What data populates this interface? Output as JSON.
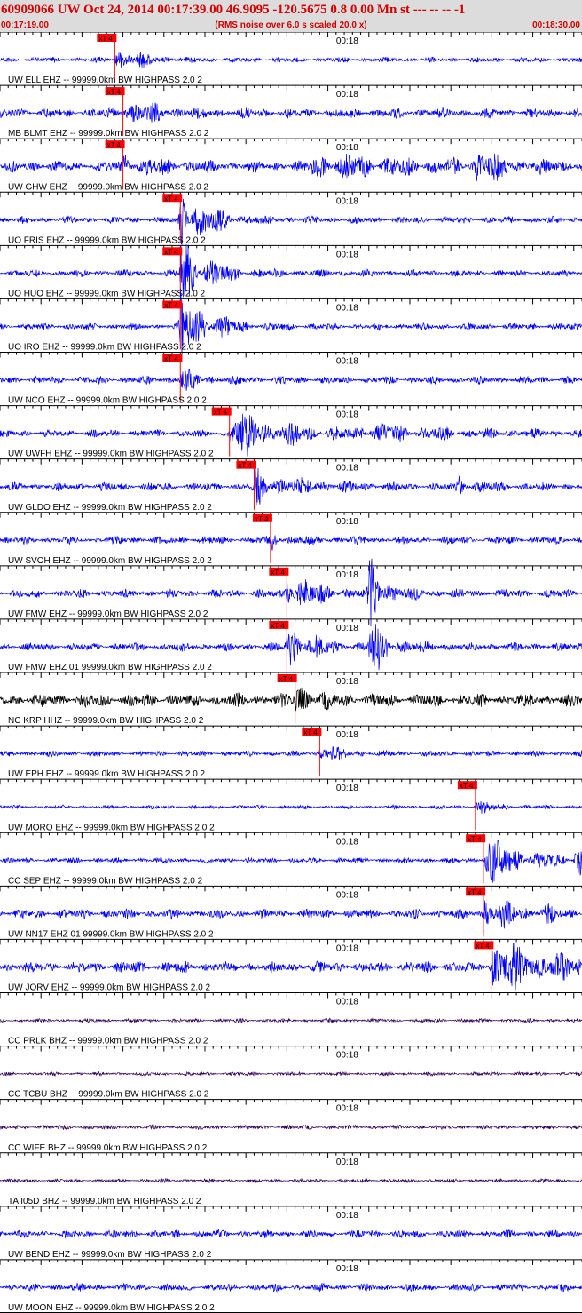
{
  "header": {
    "title": "60909066 UW Oct 24, 2014 00:17:39.00   46.9095 -120.5675  0.8 0.00 Mn st --- -- --   -1",
    "start_time": "00:17:19.00",
    "note": "(RMS noise over 6.0 s scaled 20.0 x)",
    "end_time": "00:18:30.00"
  },
  "chart_data": {
    "type": "seismogram",
    "time_range": [
      "00:17:19.00",
      "00:18:30.00"
    ],
    "time_tick_label": "00:18",
    "pick_label": "xT 4",
    "colors": {
      "blue_trace": "#0000ff",
      "black_trace": "#000000",
      "purple_trace": "#330055",
      "pick": "#ff0000",
      "header_text": "#d40000",
      "header_bg": "#dcdcdc"
    },
    "traces": [
      {
        "label": "UW ELL EHZ -- 99999.0km BW  HIGHPASS  2.0  2",
        "color": "#0000ff",
        "pick": 14,
        "noise": 0.14,
        "events": [
          [
            14,
            3,
            0.7
          ]
        ]
      },
      {
        "label": "MB BLMT EHZ -- 99999.0km BW  HIGHPASS  2.0  2",
        "color": "#0000ff",
        "pick": 15,
        "noise": 0.25,
        "events": [
          [
            15,
            4,
            0.6
          ]
        ]
      },
      {
        "label": "UW GHW EHZ -- 99999.0km BW  HIGHPASS  2.0  2",
        "color": "#0000ff",
        "pick": 15,
        "noise": 0.28,
        "events": [
          [
            15,
            4,
            0.6
          ],
          [
            38,
            14,
            0.55
          ],
          [
            58,
            3,
            0.8
          ]
        ]
      },
      {
        "label": "UO FRIS EHZ -- 99999.0km BW  HIGHPASS  2.0  2",
        "color": "#0000ff",
        "pick": 22,
        "noise": 0.18,
        "events": [
          [
            22,
            3,
            2.2
          ]
        ]
      },
      {
        "label": "UO HUO EHZ -- 99999.0km BW  HIGHPASS  2.0  2",
        "color": "#0000ff",
        "pick": 22,
        "noise": 0.18,
        "events": [
          [
            22,
            3,
            2.2
          ]
        ]
      },
      {
        "label": "UO IRO EHZ -- 99999.0km BW  HIGHPASS  2.0  2",
        "color": "#0000ff",
        "pick": 22,
        "noise": 0.18,
        "events": [
          [
            22,
            3,
            2.2
          ]
        ]
      },
      {
        "label": "UW NCO EHZ -- 99999.0km BW  HIGHPASS  2.0  2",
        "color": "#0000ff",
        "pick": 22,
        "noise": 0.2,
        "events": [
          [
            22,
            2,
            0.6
          ]
        ]
      },
      {
        "label": "UW UWFH EHZ -- 99999.0km BW  HIGHPASS  2.0  2",
        "color": "#0000ff",
        "pick": 28,
        "noise": 0.2,
        "events": [
          [
            28,
            7,
            1.2
          ],
          [
            44,
            8,
            0.4
          ]
        ]
      },
      {
        "label": "UW GLDO EHZ -- 99999.0km BW  HIGHPASS  2.0  2",
        "color": "#0000ff",
        "pick": 31,
        "noise": 0.22,
        "events": [
          [
            31,
            5,
            0.8
          ],
          [
            56,
            2,
            0.5
          ]
        ]
      },
      {
        "label": "UW SVOH EHZ -- 99999.0km BW  HIGHPASS  2.0  2",
        "color": "#0000ff",
        "pick": 33,
        "noise": 0.2,
        "events": [
          [
            33,
            2,
            0.5
          ]
        ]
      },
      {
        "label": "UW FMW EHZ -- 99999.0km BW  HIGHPASS  2.0  2",
        "color": "#0000ff",
        "pick": 35,
        "noise": 0.22,
        "events": [
          [
            35,
            2.5,
            1.8
          ],
          [
            45,
            2,
            1.8
          ],
          [
            75,
            1.5,
            1.6
          ]
        ]
      },
      {
        "label": "UW FMW EHZ 01 99999.0km BW  HIGHPASS  2.0  2",
        "color": "#0000ff",
        "pick": 35,
        "noise": 0.22,
        "events": [
          [
            35,
            2.5,
            1.8
          ],
          [
            45,
            2,
            1.8
          ],
          [
            75,
            1.5,
            1.6
          ]
        ]
      },
      {
        "label": "NC KRP HHZ -- 99999.0km BW  HIGHPASS  2.0  2",
        "color": "#000000",
        "pick": 36,
        "noise": 0.35,
        "events": [
          [
            36,
            2,
            0.9
          ]
        ]
      },
      {
        "label": "UW EPH EHZ -- 99999.0km BW  HIGHPASS  2.0  2",
        "color": "#0000ff",
        "pick": 39,
        "noise": 0.15,
        "events": [
          [
            39,
            2,
            0.7
          ]
        ]
      },
      {
        "label": "UW MORO EHZ -- 99999.0km BW  HIGHPASS  2.0  2",
        "color": "#0000ff",
        "pick": 58,
        "noise": 0.1,
        "events": [
          [
            58,
            2,
            0.4
          ]
        ]
      },
      {
        "label": "CC SEP EHZ -- 99999.0km BW  HIGHPASS  2.0  2",
        "color": "#0000ff",
        "pick": 59,
        "noise": 0.15,
        "events": [
          [
            59,
            6,
            1.2
          ],
          [
            70,
            4,
            1.0
          ]
        ]
      },
      {
        "label": "UW NN17 EHZ 01 99999.0km BW  HIGHPASS  2.0  2",
        "color": "#0000ff",
        "pick": 59,
        "noise": 0.25,
        "events": [
          [
            59,
            3,
            1.1
          ],
          [
            66,
            1,
            0.5
          ]
        ]
      },
      {
        "label": "UW JORV EHZ -- 99999.0km BW  HIGHPASS  2.0  2",
        "color": "#0000ff",
        "pick": 60,
        "noise": 0.3,
        "events": [
          [
            60,
            8,
            1.3
          ]
        ]
      },
      {
        "label": "CC PRLK BHZ -- 99999.0km BW  HIGHPASS  2.0  2",
        "color": "#330055",
        "pick": null,
        "noise": 0.1,
        "events": []
      },
      {
        "label": "CC TCBU BHZ -- 99999.0km BW  HIGHPASS  2.0  2",
        "color": "#330055",
        "pick": null,
        "noise": 0.1,
        "events": []
      },
      {
        "label": "CC WIFE BHZ -- 99999.0km BW  HIGHPASS  2.0  2",
        "color": "#330055",
        "pick": null,
        "noise": 0.12,
        "events": []
      },
      {
        "label": "TA I05D BHZ -- 99999.0km BW  HIGHPASS  2.0  2",
        "color": "#330055",
        "pick": null,
        "noise": 0.1,
        "events": []
      },
      {
        "label": "UW BEND EHZ -- 99999.0km BW  HIGHPASS  2.0  2",
        "color": "#0000ff",
        "pick": null,
        "noise": 0.2,
        "events": []
      },
      {
        "label": "UW MOON EHZ -- 99999.0km BW  HIGHPASS  2.0  2",
        "color": "#0000ff",
        "pick": null,
        "noise": 0.2,
        "events": []
      }
    ]
  }
}
